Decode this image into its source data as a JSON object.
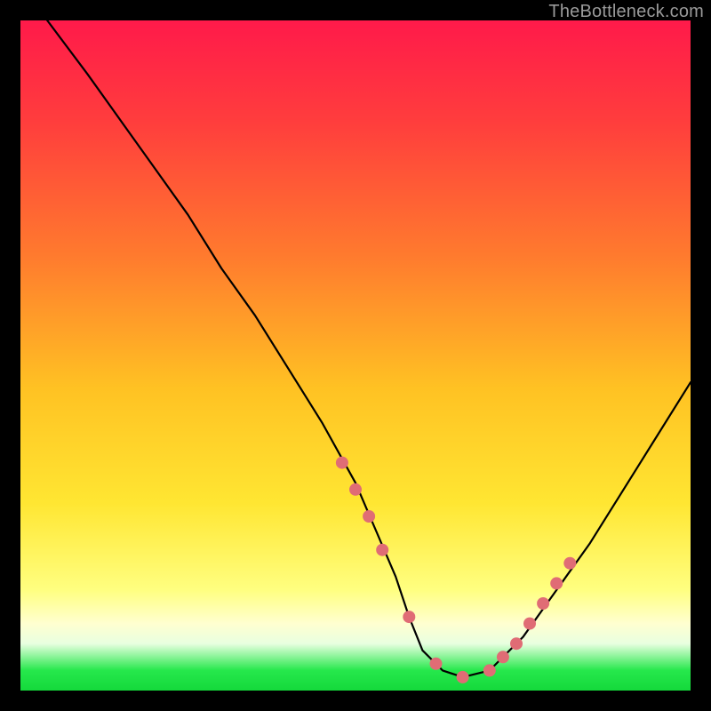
{
  "watermark": "TheBottleneck.com",
  "chart_data": {
    "type": "line",
    "title": "",
    "xlabel": "",
    "ylabel": "",
    "xlim": [
      0,
      100
    ],
    "ylim": [
      0,
      100
    ],
    "grid": false,
    "legend": false,
    "series": [
      {
        "name": "bottleneck-curve",
        "color": "#000000",
        "x": [
          4,
          10,
          15,
          20,
          25,
          30,
          35,
          40,
          45,
          50,
          53,
          56,
          58,
          60,
          63,
          66,
          70,
          75,
          80,
          85,
          90,
          95,
          100
        ],
        "values": [
          100,
          92,
          85,
          78,
          71,
          63,
          56,
          48,
          40,
          31,
          24,
          17,
          11,
          6,
          3,
          2,
          3,
          8,
          15,
          22,
          30,
          38,
          46
        ]
      }
    ],
    "markers": {
      "name": "highlight-points",
      "color": "#e06c75",
      "radius": 7,
      "x": [
        48,
        50,
        52,
        54,
        58,
        62,
        66,
        70,
        72,
        74,
        76,
        78,
        80,
        82
      ],
      "values": [
        34,
        30,
        26,
        21,
        11,
        4,
        2,
        3,
        5,
        7,
        10,
        13,
        16,
        19
      ]
    },
    "background_gradient": {
      "stops": [
        {
          "pos": 0,
          "color": "#ff1a4a"
        },
        {
          "pos": 15,
          "color": "#ff3d3d"
        },
        {
          "pos": 35,
          "color": "#ff7a2e"
        },
        {
          "pos": 55,
          "color": "#ffc223"
        },
        {
          "pos": 72,
          "color": "#ffe632"
        },
        {
          "pos": 85,
          "color": "#ffff80"
        },
        {
          "pos": 90,
          "color": "#ffffd0"
        },
        {
          "pos": 93,
          "color": "#e8ffe0"
        },
        {
          "pos": 97,
          "color": "#26e84c"
        },
        {
          "pos": 100,
          "color": "#14d93b"
        }
      ]
    }
  }
}
